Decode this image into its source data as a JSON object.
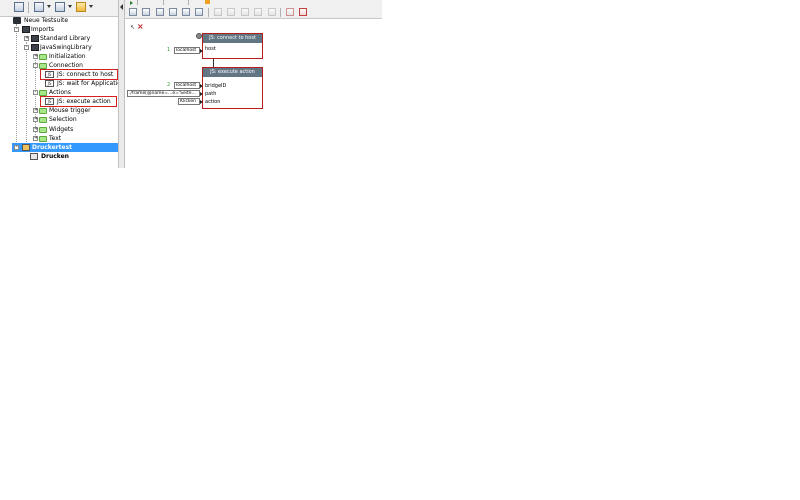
{
  "tree": {
    "items": [
      {
        "label": "Neue Testsuite"
      },
      {
        "label": "Imports"
      },
      {
        "label": "Standard Library"
      },
      {
        "label": "JavaSwingLibrary"
      },
      {
        "label": "Initialization"
      },
      {
        "label": "Connection"
      },
      {
        "label": "JS: connect to host"
      },
      {
        "label": "JS: wait for Application"
      },
      {
        "label": "Actions"
      },
      {
        "label": "JS: execute action"
      },
      {
        "label": "Mouse trigger"
      },
      {
        "label": "Selection"
      },
      {
        "label": "Widgets"
      },
      {
        "label": "Text"
      },
      {
        "label": "Druckertest"
      },
      {
        "label": "Drucken"
      }
    ]
  },
  "canvas": {
    "block1": {
      "title": "JS: connect to host",
      "ports": [
        "host"
      ],
      "number": "1",
      "params": [
        "localhost"
      ]
    },
    "block2": {
      "title": "JS: execute action",
      "ports": [
        "bridgeID",
        "path",
        "action"
      ],
      "number": "2",
      "params": [
        "localhost",
        "./frame[@name=...e='Seite...",
        "Klicken"
      ]
    }
  },
  "colors": {
    "block_header": "#617583",
    "block_border": "#b51c1c",
    "selection": "#3399ff",
    "highlight_box": "#d42020"
  }
}
